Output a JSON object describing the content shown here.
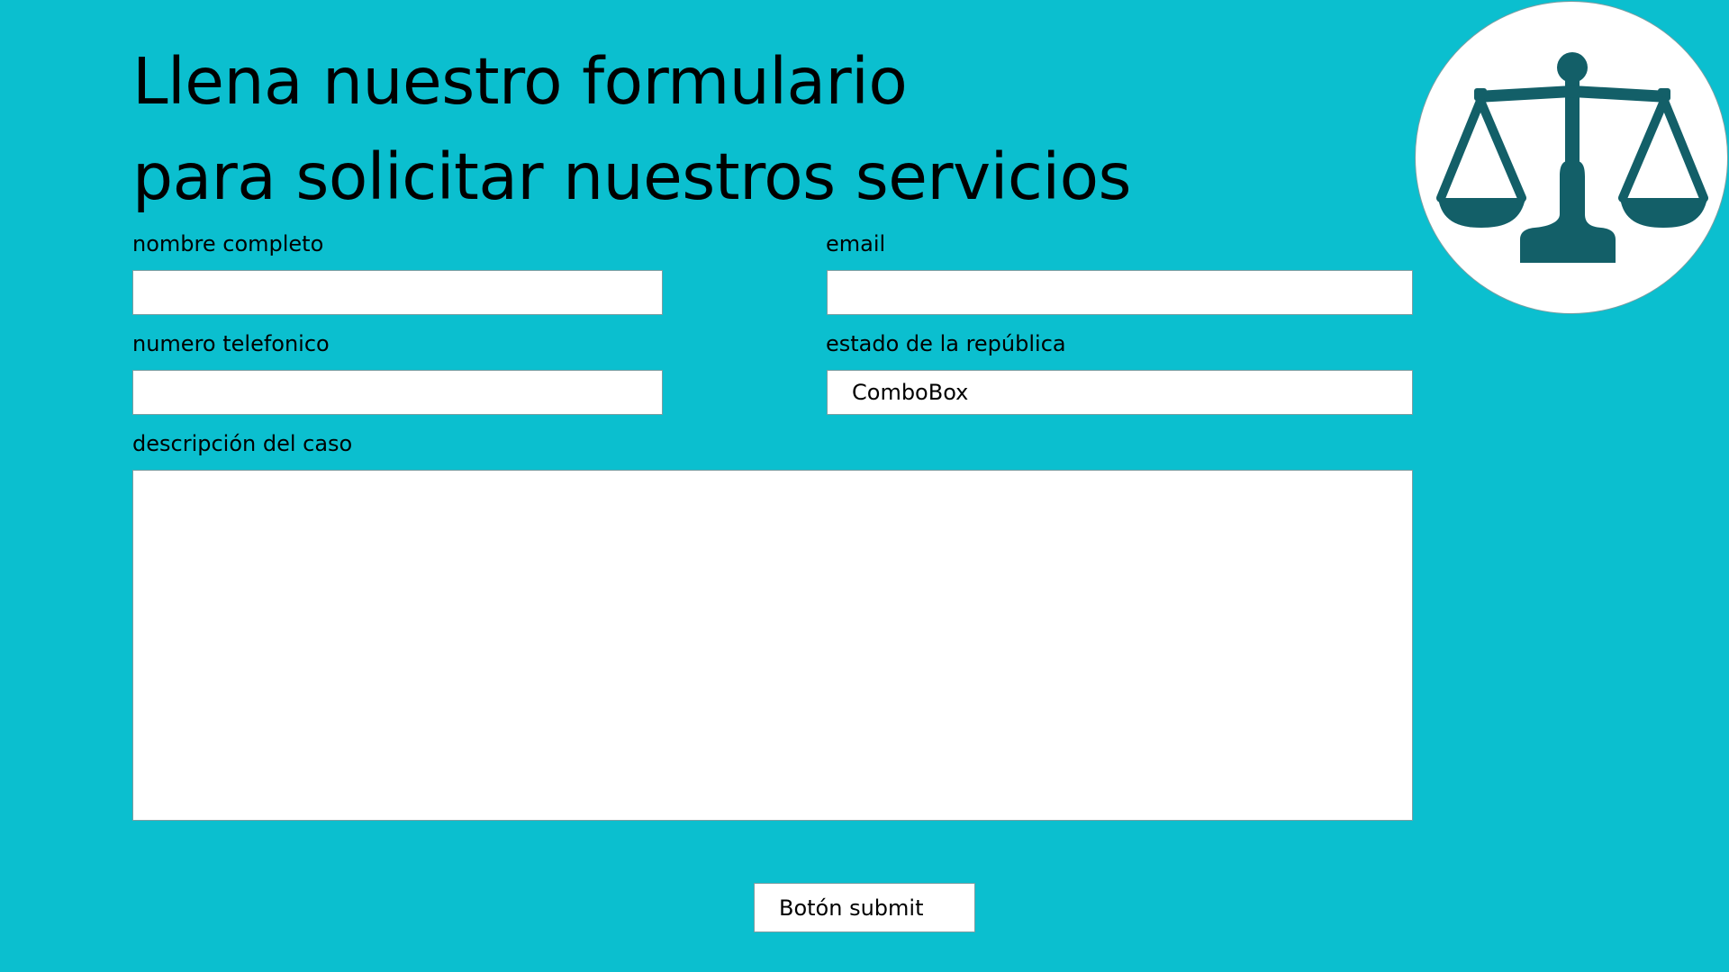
{
  "header": {
    "title_line1": "Llena nuestro formulario",
    "title_line2": "para solicitar nuestros servicios"
  },
  "form": {
    "name_label": "nombre completo",
    "email_label": "email",
    "phone_label": "numero telefonico",
    "state_label": "estado de la república",
    "state_value": "ComboBox",
    "description_label": "descripción del caso",
    "name_value": "",
    "email_value": "",
    "phone_value": "",
    "description_value": ""
  },
  "actions": {
    "submit_label": "Botón submit"
  },
  "logo": {
    "icon": "scales-of-justice-icon",
    "icon_color": "#135f68"
  },
  "colors": {
    "background": "#0bbfcf",
    "field_background": "#ffffff",
    "border": "#7a9ea2"
  }
}
